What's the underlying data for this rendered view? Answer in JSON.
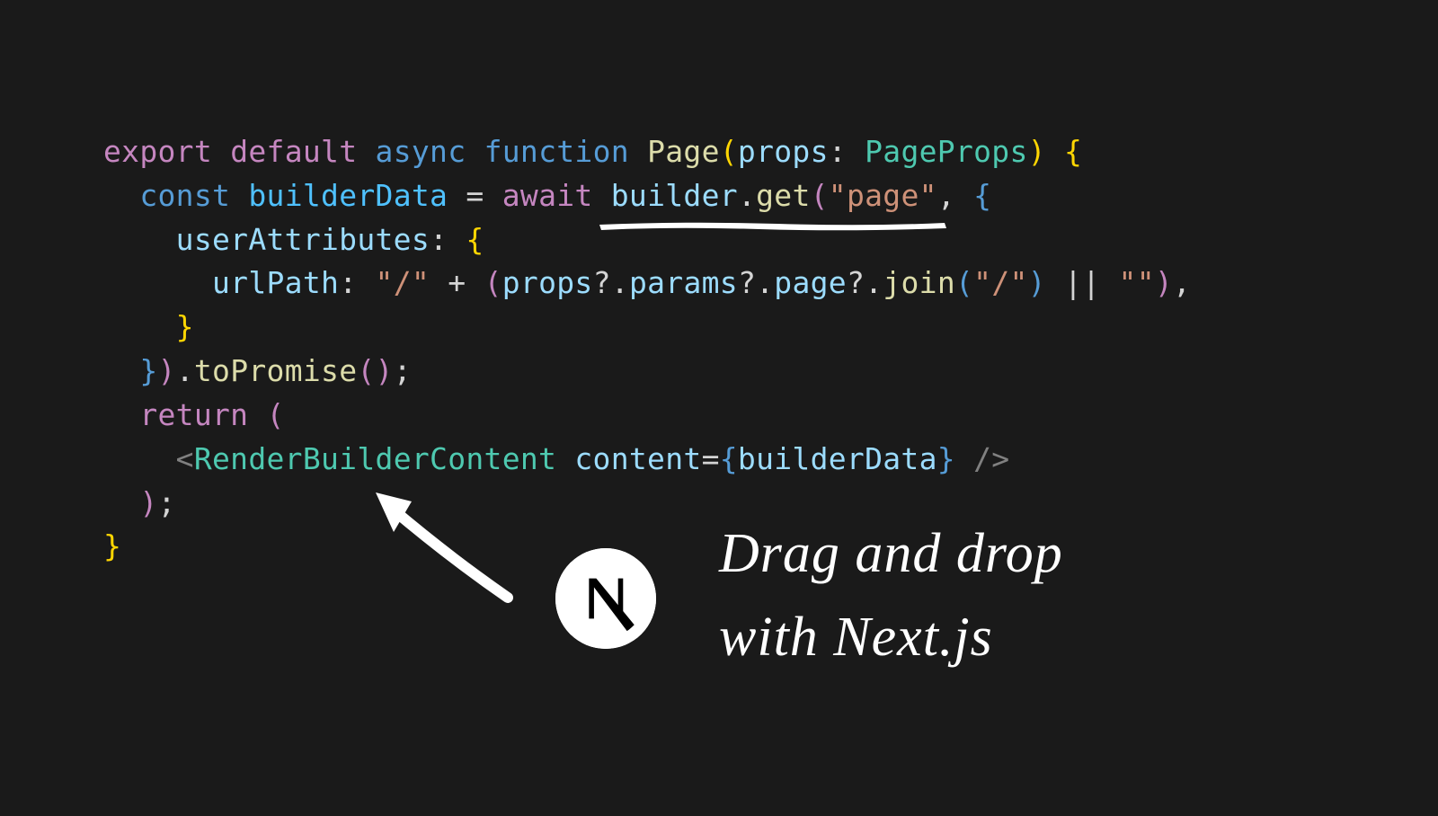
{
  "code": {
    "line1": {
      "export": "export",
      "default": "default",
      "async": "async",
      "function": "function",
      "fnName": "Page",
      "param": "props",
      "colon": ":",
      "type": "PageProps"
    },
    "line2": {
      "const": "const",
      "var": "builderData",
      "eq": "=",
      "await": "await",
      "obj": "builder",
      "method": "get",
      "string": "\"page\"",
      "comma": ","
    },
    "line3": {
      "prop": "userAttributes",
      "colon": ":"
    },
    "line4": {
      "prop": "urlPath",
      "colon": ":",
      "str1": "\"/\"",
      "plus": "+",
      "props": "props",
      "params": "params",
      "page": "page",
      "join": "join",
      "joinArg": "\"/\"",
      "or": "||",
      "empty": "\"\"",
      "comma": ","
    },
    "line6": {
      "toPromise": "toPromise"
    },
    "line7": {
      "return": "return"
    },
    "line8": {
      "component": "RenderBuilderContent",
      "attr": "content",
      "val": "builderData"
    }
  },
  "annotation": {
    "line1": "Drag and drop",
    "line2": "with Next.js"
  }
}
